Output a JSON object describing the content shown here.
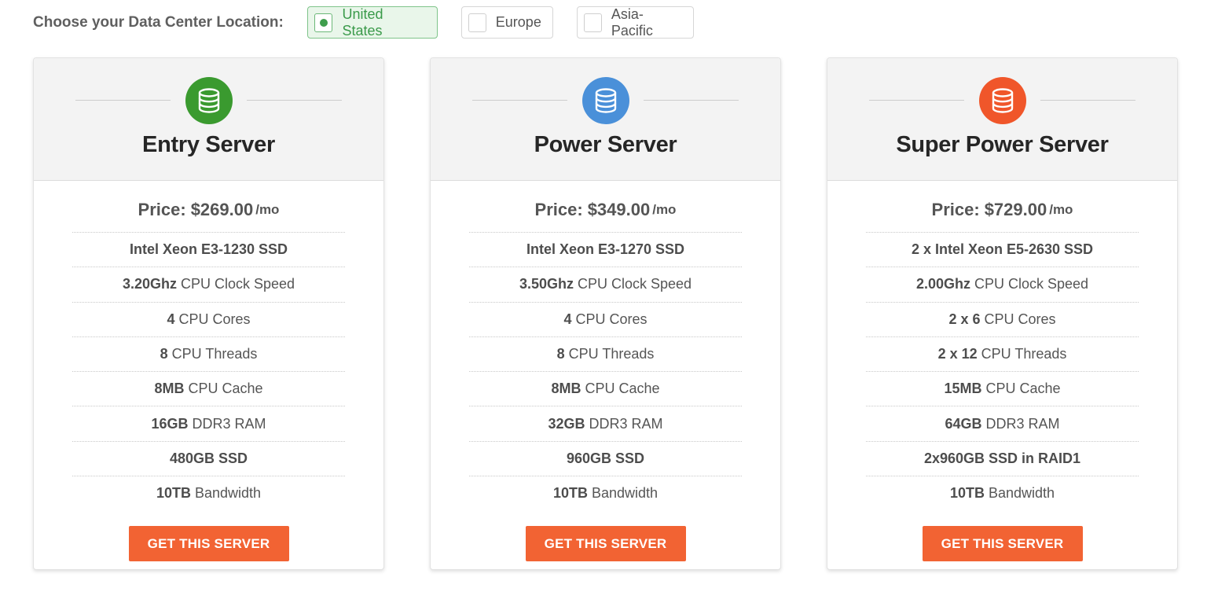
{
  "location": {
    "label": "Choose your Data Center Location:",
    "options": [
      {
        "label": "United States",
        "selected": true
      },
      {
        "label": "Europe",
        "selected": false
      },
      {
        "label": "Asia-Pacific",
        "selected": false
      }
    ]
  },
  "plans": [
    {
      "title": "Entry Server",
      "icon": "database-icon",
      "icon_color": "#3a9a2f",
      "price_label": "Price:",
      "price": "$269.00",
      "price_unit": "/mo",
      "features": [
        {
          "bold": "Intel Xeon E3-1230 SSD",
          "text": ""
        },
        {
          "bold": "3.20Ghz",
          "text": "CPU Clock Speed"
        },
        {
          "bold": "4",
          "text": "CPU Cores"
        },
        {
          "bold": "8",
          "text": "CPU Threads"
        },
        {
          "bold": "8MB",
          "text": "CPU Cache"
        },
        {
          "bold": "16GB",
          "text": "DDR3 RAM"
        },
        {
          "bold": "480GB SSD",
          "text": ""
        },
        {
          "bold": "10TB",
          "text": "Bandwidth"
        }
      ],
      "button": "GET THIS SERVER"
    },
    {
      "title": "Power Server",
      "icon": "database-icon",
      "icon_color": "#4a90d9",
      "price_label": "Price:",
      "price": "$349.00",
      "price_unit": "/mo",
      "features": [
        {
          "bold": "Intel Xeon E3-1270 SSD",
          "text": ""
        },
        {
          "bold": "3.50Ghz",
          "text": "CPU Clock Speed"
        },
        {
          "bold": "4",
          "text": "CPU Cores"
        },
        {
          "bold": "8",
          "text": "CPU Threads"
        },
        {
          "bold": "8MB",
          "text": "CPU Cache"
        },
        {
          "bold": "32GB",
          "text": "DDR3 RAM"
        },
        {
          "bold": "960GB SSD",
          "text": ""
        },
        {
          "bold": "10TB",
          "text": "Bandwidth"
        }
      ],
      "button": "GET THIS SERVER"
    },
    {
      "title": "Super Power Server",
      "icon": "database-icon",
      "icon_color": "#f0562a",
      "price_label": "Price:",
      "price": "$729.00",
      "price_unit": "/mo",
      "features": [
        {
          "bold": "2 x Intel Xeon E5-2630 SSD",
          "text": ""
        },
        {
          "bold": "2.00Ghz",
          "text": "CPU Clock Speed"
        },
        {
          "bold": "2 x 6",
          "text": "CPU Cores"
        },
        {
          "bold": "2 x 12",
          "text": "CPU Threads"
        },
        {
          "bold": "15MB",
          "text": "CPU Cache"
        },
        {
          "bold": "64GB",
          "text": "DDR3 RAM"
        },
        {
          "bold": "2x960GB SSD in RAID1",
          "text": ""
        },
        {
          "bold": "10TB",
          "text": "Bandwidth"
        }
      ],
      "button": "GET THIS SERVER"
    }
  ],
  "colors": {
    "accent": "#f26333",
    "selected_bg": "#e9f6ea",
    "selected_text": "#3a9a4a"
  }
}
